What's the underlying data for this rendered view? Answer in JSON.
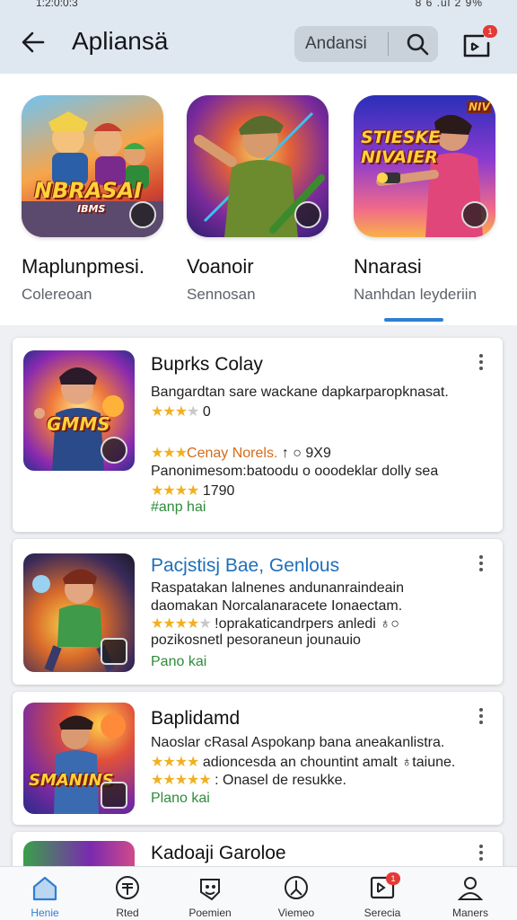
{
  "status": {
    "left": "1:2:0:0:3",
    "right": "8 6 .ul 2 9%"
  },
  "appbar": {
    "title": "Apliansä",
    "search_text": "Andansi",
    "badge": "1"
  },
  "featured": [
    {
      "title": "Maplunpmesi.",
      "subtitle": "Colereoan",
      "art_text": "NBRASAI",
      "art_sub": "IBMS"
    },
    {
      "title": "Voanoir",
      "subtitle": "Sennosan"
    },
    {
      "title": "Nnarasi",
      "subtitle": "Nanhdan leyderiin",
      "art_text": "STIESKE NIVAIER",
      "art_tag": "NIV"
    }
  ],
  "list": [
    {
      "title": "Buprks Colay",
      "art_text": "GMMS",
      "lines": [
        {
          "text": "Bangardtan sare wackane dapkarparopknasat."
        },
        {
          "stars": "★★★",
          "stars_off": "★",
          "after": " 0"
        },
        {
          "stars": "★★★",
          "orange": "Cenay Norels.",
          "after": " ↑ ○ 9X9"
        },
        {
          "text": "Panonimesom:batoodu o ooodeklar dolly sea"
        },
        {
          "stars": "★★★★",
          "after": " 1790"
        },
        {
          "text": "#anp hai",
          "green": true
        }
      ]
    },
    {
      "title": "Pacjstisj Bae, Genlous",
      "lines": [
        {
          "text": "Raspatakan lalnenes andunanraindeain"
        },
        {
          "text": "daomakan Norcalanaracete Ionaectam."
        },
        {
          "stars": "★★★★",
          "stars_off": "★",
          "after": " !oprakaticandrpers anledi ♁○"
        },
        {
          "text": "pozikosnetl pesoraneun jounauio"
        },
        {
          "text": "Pano kai",
          "green": true
        }
      ]
    },
    {
      "title": "Baplidamd",
      "art_text": "SMANINS",
      "lines": [
        {
          "text": "Naoslar cRasal Aspokanp bana aneakanlistra."
        },
        {
          "stars": "★★★★",
          "after": " adioncesda an chountint amalt ♁taiune."
        },
        {
          "stars": "★★★★★",
          "after": " : Onasel de resukke."
        },
        {
          "text": "Plano kai",
          "green": true
        }
      ]
    },
    {
      "title": "Kadoaji Garoloe"
    }
  ],
  "nav": [
    {
      "label": "Henie",
      "icon": "home-icon",
      "active": true
    },
    {
      "label": "Rted",
      "icon": "rated-icon"
    },
    {
      "label": "Poemien",
      "icon": "premium-icon"
    },
    {
      "label": "Viemeo",
      "icon": "video-icon"
    },
    {
      "label": "Serecia",
      "icon": "service-icon",
      "badge": "1"
    },
    {
      "label": "Maners",
      "icon": "profile-icon"
    }
  ],
  "colors": {
    "accent": "#2f7fd2",
    "star": "#f2b01e",
    "green": "#2e8b3a",
    "badge": "#e53935"
  }
}
